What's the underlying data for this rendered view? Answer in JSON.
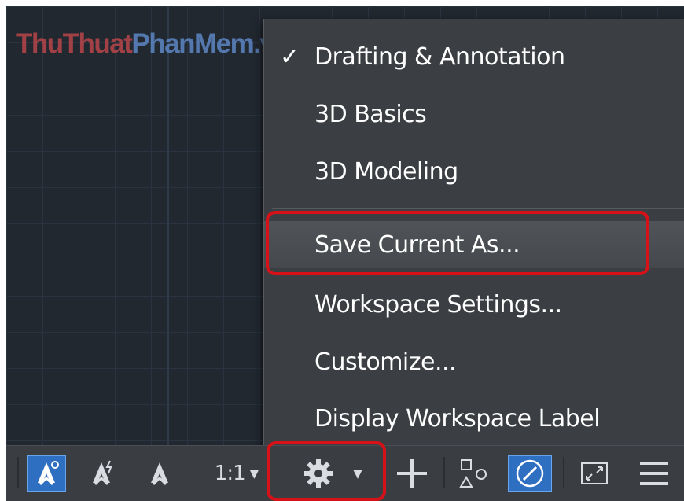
{
  "watermark": {
    "part1": "ThuThuat",
    "part2": "PhanMem",
    "part3": ".vn"
  },
  "menu": {
    "items": [
      {
        "label": "Drafting & Annotation",
        "checked": true,
        "check_glyph": "✓"
      },
      {
        "label": "3D Basics",
        "checked": false
      },
      {
        "label": "3D Modeling",
        "checked": false
      },
      {
        "label": "Save Current As...",
        "hover": true
      },
      {
        "label": "Workspace Settings..."
      },
      {
        "label": "Customize..."
      },
      {
        "label": "Display Workspace Label"
      }
    ]
  },
  "statusbar": {
    "annotation_scale": "1:1",
    "icons": [
      "annotation-visibility-icon",
      "autoscale-icon",
      "annotation-scale-icon",
      "workspace-switching-gear-icon",
      "plus-icon",
      "isolate-objects-icon",
      "hardware-acceleration-icon",
      "clean-screen-icon",
      "customization-menu-icon"
    ]
  },
  "colors": {
    "highlight": "#d61118",
    "active_button": "#2f6fc2",
    "menu_bg": "#3b3e42",
    "canvas_bg": "#212830"
  }
}
